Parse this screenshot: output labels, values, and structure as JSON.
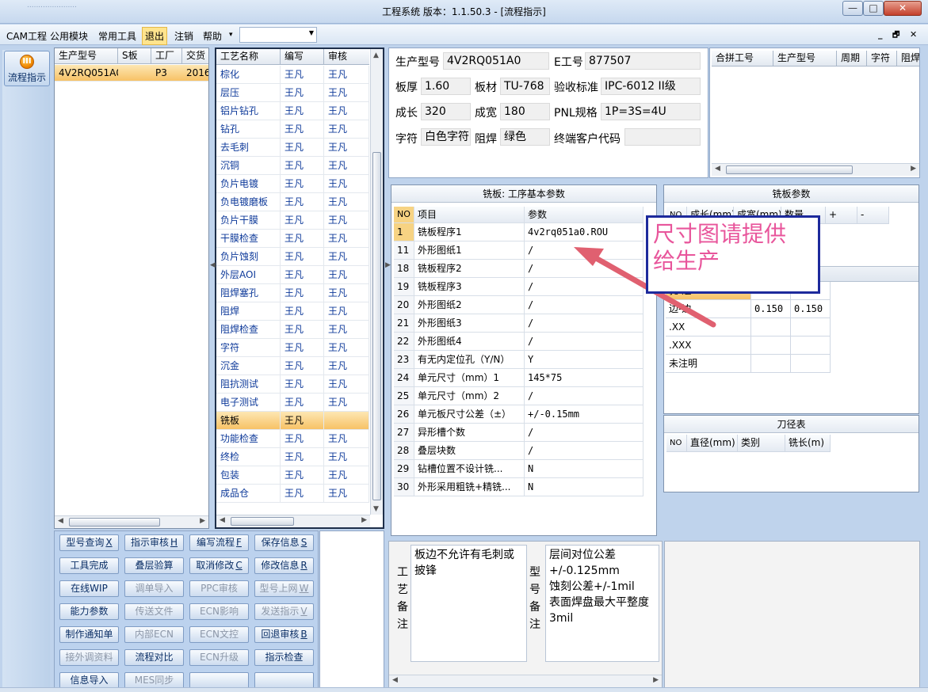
{
  "window": {
    "title": "工程系统   版本：1.1.50.3 - [流程指示]",
    "faded_title": "......................",
    "controls": {
      "minimize": "—",
      "maximize": "□",
      "close": "✕"
    }
  },
  "menu": {
    "items": [
      "CAM工程",
      "公用模块",
      "常用工具",
      "退出",
      "注销",
      "帮助"
    ],
    "help_arrow": "▾",
    "combo_value": "",
    "mdi_controls": {
      "minimize": "_",
      "restore": "🗗",
      "close": "✕"
    }
  },
  "sidebar": {
    "button_label": "流程指示",
    "icon_glyph": "III"
  },
  "orders": {
    "headers": [
      "生产型号",
      "S板",
      "工厂",
      "交货"
    ],
    "rows": [
      {
        "model": "4V2RQ051A0",
        "s": "",
        "factory": "P3",
        "date": "2016"
      }
    ]
  },
  "steps": {
    "headers": [
      "工艺名称",
      "编写",
      "审核"
    ],
    "rows": [
      {
        "name": "棕化",
        "writer": "王凡",
        "reviewer": "王凡"
      },
      {
        "name": "层压",
        "writer": "王凡",
        "reviewer": "王凡"
      },
      {
        "name": "铝片钻孔",
        "writer": "王凡",
        "reviewer": "王凡"
      },
      {
        "name": "钻孔",
        "writer": "王凡",
        "reviewer": "王凡"
      },
      {
        "name": "去毛刺",
        "writer": "王凡",
        "reviewer": "王凡"
      },
      {
        "name": "沉铜",
        "writer": "王凡",
        "reviewer": "王凡"
      },
      {
        "name": "负片电镀",
        "writer": "王凡",
        "reviewer": "王凡"
      },
      {
        "name": "负电镀磨板",
        "writer": "王凡",
        "reviewer": "王凡"
      },
      {
        "name": "负片干膜",
        "writer": "王凡",
        "reviewer": "王凡"
      },
      {
        "name": "干膜检查",
        "writer": "王凡",
        "reviewer": "王凡"
      },
      {
        "name": "负片蚀刻",
        "writer": "王凡",
        "reviewer": "王凡"
      },
      {
        "name": "外层AOI",
        "writer": "王凡",
        "reviewer": "王凡"
      },
      {
        "name": "阻焊塞孔",
        "writer": "王凡",
        "reviewer": "王凡"
      },
      {
        "name": "阻焊",
        "writer": "王凡",
        "reviewer": "王凡"
      },
      {
        "name": "阻焊检查",
        "writer": "王凡",
        "reviewer": "王凡"
      },
      {
        "name": "字符",
        "writer": "王凡",
        "reviewer": "王凡"
      },
      {
        "name": "沉金",
        "writer": "王凡",
        "reviewer": "王凡"
      },
      {
        "name": "阻抗测试",
        "writer": "王凡",
        "reviewer": "王凡"
      },
      {
        "name": "电子测试",
        "writer": "王凡",
        "reviewer": "王凡"
      },
      {
        "name": "铣板",
        "writer": "王凡",
        "reviewer": ""
      },
      {
        "name": "功能检查",
        "writer": "王凡",
        "reviewer": "王凡"
      },
      {
        "name": "终检",
        "writer": "王凡",
        "reviewer": "王凡"
      },
      {
        "name": "包装",
        "writer": "王凡",
        "reviewer": "王凡"
      },
      {
        "name": "成品仓",
        "writer": "王凡",
        "reviewer": "王凡"
      }
    ],
    "selected_index": 19
  },
  "buttons": [
    {
      "label": "型号查询",
      "key": "X",
      "enabled": true
    },
    {
      "label": "指示审核",
      "key": "H",
      "enabled": true
    },
    {
      "label": "编写流程",
      "key": "F",
      "enabled": true
    },
    {
      "label": "保存信息",
      "key": "S",
      "enabled": true
    },
    {
      "label": "工具完成",
      "key": "",
      "enabled": true
    },
    {
      "label": "叠层验算",
      "key": "",
      "enabled": true
    },
    {
      "label": "取消修改",
      "key": "C",
      "enabled": true
    },
    {
      "label": "修改信息",
      "key": "R",
      "enabled": true
    },
    {
      "label": "在线WIP",
      "key": "",
      "enabled": true
    },
    {
      "label": "调单导入",
      "key": "",
      "enabled": false
    },
    {
      "label": "PPC审核",
      "key": "",
      "enabled": false
    },
    {
      "label": "型号上网",
      "key": "W",
      "enabled": false
    },
    {
      "label": "能力参数",
      "key": "",
      "enabled": true
    },
    {
      "label": "传送文件",
      "key": "",
      "enabled": false
    },
    {
      "label": "ECN影响",
      "key": "",
      "enabled": false
    },
    {
      "label": "发送指示",
      "key": "V",
      "enabled": false
    },
    {
      "label": "制作通知单",
      "key": "",
      "enabled": true
    },
    {
      "label": "内部ECN",
      "key": "",
      "enabled": false
    },
    {
      "label": "ECN文控",
      "key": "",
      "enabled": false
    },
    {
      "label": "回退审核",
      "key": "B",
      "enabled": true
    },
    {
      "label": "接外调资料",
      "key": "",
      "enabled": false
    },
    {
      "label": "流程对比",
      "key": "",
      "enabled": true
    },
    {
      "label": "ECN升级",
      "key": "",
      "enabled": false
    },
    {
      "label": "指示检查",
      "key": "",
      "enabled": true
    },
    {
      "label": "信息导入",
      "key": "",
      "enabled": true
    },
    {
      "label": "MES同步",
      "key": "",
      "enabled": false
    },
    {
      "label": "",
      "key": "",
      "enabled": true
    },
    {
      "label": "",
      "key": "",
      "enabled": true
    }
  ],
  "info": {
    "model_label": "生产型号",
    "model": "4V2RQ051A0",
    "e_no_label": "E工号",
    "e_no": "877507",
    "thickness_label": "板厚",
    "thickness": "1.60",
    "material_label": "板材",
    "material": "TU-768",
    "standard_label": "验收标准",
    "standard": "IPC-6012 II级",
    "length_label": "成长",
    "length": "320",
    "width_label": "成宽",
    "width": "180",
    "pnl_label": "PNL规格",
    "pnl": "1P=3S=4U",
    "char_label": "字符",
    "char": "白色字符",
    "mask_label": "阻焊",
    "mask": "绿色",
    "customer_label": "终端客户代码",
    "customer": ""
  },
  "combine": {
    "headers": [
      "合拼工号",
      "生产型号",
      "周期",
      "字符",
      "阻焊"
    ]
  },
  "params": {
    "title": "铣板: 工序基本参数",
    "headers": [
      "NO",
      "项目",
      "参数"
    ],
    "rows": [
      {
        "no": "1",
        "item": "铣板程序1",
        "value": "4v2rq051a0.ROU"
      },
      {
        "no": "11",
        "item": "外形图纸1",
        "value": "/"
      },
      {
        "no": "18",
        "item": "铣板程序2",
        "value": "/"
      },
      {
        "no": "19",
        "item": "铣板程序3",
        "value": "/"
      },
      {
        "no": "20",
        "item": "外形图纸2",
        "value": "/"
      },
      {
        "no": "21",
        "item": "外形图纸3",
        "value": "/"
      },
      {
        "no": "22",
        "item": "外形图纸4",
        "value": "/"
      },
      {
        "no": "23",
        "item": "有无内定位孔（Y/N）",
        "value": "Y"
      },
      {
        "no": "24",
        "item": "单元尺寸（mm）1",
        "value": "145*75"
      },
      {
        "no": "25",
        "item": "单元尺寸（mm）2",
        "value": "/"
      },
      {
        "no": "26",
        "item": "单元板尺寸公差（±）",
        "value": "+/-0.15mm"
      },
      {
        "no": "27",
        "item": "异形槽个数",
        "value": "/"
      },
      {
        "no": "28",
        "item": "叠层块数",
        "value": "/"
      },
      {
        "no": "29",
        "item": "钻槽位置不设计铣...",
        "value": "N"
      },
      {
        "no": "30",
        "item": "外形采用粗铣+精铣...",
        "value": "N"
      }
    ]
  },
  "mill": {
    "title": "铣板参数",
    "headers": [
      "NO",
      "成长(mm)",
      "成宽(mm)",
      "数量",
      "+",
      "-"
    ],
    "tol_rows": [
      {
        "label": "孔-边",
        "a": "",
        "b": ""
      },
      {
        "label": "边-边",
        "a": "0.150",
        "b": "0.150"
      },
      {
        "label": ".XX",
        "a": "",
        "b": ""
      },
      {
        "label": ".XXX",
        "a": "",
        "b": ""
      },
      {
        "label": "未注明",
        "a": "",
        "b": ""
      }
    ]
  },
  "tools": {
    "title": "刀径表",
    "headers": [
      "NO",
      "直径(mm)",
      "类别",
      "铣长(m)"
    ]
  },
  "notes": {
    "process_label": "工艺备注",
    "process_text": "板边不允许有毛刺或披锋",
    "model_label": "型号备注",
    "model_text": "层间对位公差+/-0.125mm\n蚀刻公差+/-1mil\n表面焊盘最大平整度3mil"
  },
  "annotation": {
    "text": "尺寸图请提供\n给生产",
    "color": "#e8559b",
    "border": "#1d2a9c",
    "arrow_color": "#e06070"
  }
}
